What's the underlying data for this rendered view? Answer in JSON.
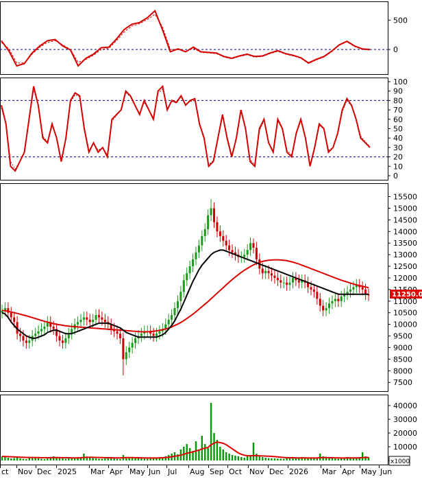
{
  "colors": {
    "primary_line": "#d40000",
    "signal_line": "#d40000",
    "ma_fast": "#000000",
    "ma_slow": "#dd0000",
    "up_candle": "#1a9a1a",
    "down_candle": "#cc0000",
    "volume": "#009900",
    "volume_ma": "#dd0000",
    "ref_line": "#00008b",
    "price_tag_bg": "#dd0000"
  },
  "current_price_label": "11250.00",
  "volume_unit_label": "x1000",
  "chart_data": [
    {
      "id": "macd",
      "type": "line",
      "yticks": [
        "500",
        "0"
      ],
      "ylim": [
        -350,
        750
      ],
      "reference_lines": [
        0
      ],
      "x": [
        0,
        4,
        8,
        12,
        16,
        20,
        24,
        28,
        32,
        36,
        40,
        44,
        48,
        52,
        56,
        60,
        64,
        68,
        72,
        76,
        80,
        84,
        88,
        92,
        96,
        100
      ],
      "series": [
        {
          "role": "macd",
          "values": [
            150,
            -30,
            -280,
            -240,
            -60,
            60,
            150,
            170,
            60,
            -10,
            -280,
            -150,
            -80,
            30,
            40,
            180,
            340,
            430,
            460,
            540,
            660,
            330,
            -40,
            10,
            -40,
            40
          ]
        },
        {
          "role": "signal",
          "values": [
            120,
            10,
            -230,
            -230,
            -80,
            40,
            120,
            150,
            80,
            0,
            -220,
            -170,
            -100,
            0,
            20,
            150,
            300,
            400,
            440,
            510,
            600,
            380,
            0,
            0,
            -30,
            20
          ]
        },
        {
          "role": "macd_cont",
          "values": [
            -40,
            -50,
            -60,
            -120,
            -150,
            -110,
            -80,
            -120,
            -110,
            -60,
            -20,
            -70,
            -100,
            -140,
            -230,
            -170,
            -120,
            -30,
            80,
            140,
            60,
            10,
            0
          ]
        }
      ]
    },
    {
      "id": "stochastic",
      "type": "line",
      "yticks": [
        "100",
        "90",
        "80",
        "70",
        "60",
        "50",
        "40",
        "30",
        "20",
        "10",
        "0"
      ],
      "ylim": [
        0,
        100
      ],
      "reference_lines": [
        80,
        20
      ],
      "series": [
        {
          "role": "k",
          "values": [
            75,
            55,
            10,
            5,
            15,
            25,
            60,
            95,
            75,
            40,
            35,
            55,
            40,
            15,
            40,
            80,
            88,
            85,
            50,
            25,
            35,
            25,
            30,
            20,
            60,
            65,
            70,
            90,
            85,
            75,
            65,
            80,
            70,
            60,
            90,
            95,
            70,
            80,
            78,
            85,
            75,
            80,
            82,
            55,
            40,
            10,
            15,
            40,
            65,
            40,
            20,
            40,
            70,
            50,
            15,
            10,
            50,
            60,
            35,
            25,
            60,
            50,
            25,
            20,
            45,
            60,
            40,
            10,
            30,
            55,
            50,
            25,
            30,
            45,
            70,
            82,
            75,
            60,
            40,
            35,
            30
          ]
        },
        {
          "role": "d",
          "values": [
            72,
            55,
            15,
            7,
            15,
            25,
            58,
            92,
            74,
            42,
            36,
            53,
            41,
            17,
            40,
            78,
            86,
            84,
            52,
            27,
            35,
            27,
            30,
            22,
            58,
            64,
            70,
            88,
            84,
            75,
            66,
            78,
            70,
            62,
            88,
            92,
            71,
            79,
            77,
            84,
            76,
            79,
            80,
            56,
            41,
            12,
            16,
            40,
            63,
            42,
            22,
            40,
            68,
            50,
            17,
            12,
            48,
            58,
            36,
            26,
            58,
            50,
            27,
            22,
            44,
            58,
            41,
            12,
            30,
            53,
            50,
            27,
            30,
            44,
            68,
            80,
            74,
            60,
            42,
            36,
            31
          ]
        }
      ]
    },
    {
      "id": "price",
      "type": "candlestick",
      "yticks": [
        "15500",
        "15000",
        "14500",
        "14000",
        "13500",
        "13000",
        "12500",
        "12000",
        "11500",
        "11000",
        "10500",
        "10000",
        "9500",
        "9000",
        "8500",
        "8000",
        "7500"
      ],
      "ylim": [
        7300,
        15900
      ],
      "x_labels": [
        "ct",
        "Nov",
        "Dec",
        "2025",
        "Mar",
        "Apr",
        "May",
        "Jun",
        "Jul",
        "Aug",
        "Sep",
        "Oct",
        "Nov",
        "Dec",
        "2026",
        "Mar",
        "Apr",
        "May",
        "Jun"
      ],
      "closes": [
        10600,
        10700,
        10500,
        10300,
        10100,
        9600,
        9500,
        9300,
        9200,
        9300,
        9500,
        9600,
        9700,
        9800,
        9900,
        10100,
        9900,
        9800,
        9500,
        9300,
        9200,
        9400,
        9600,
        9800,
        10000,
        10100,
        10200,
        10300,
        10200,
        10100,
        10200,
        10400,
        10300,
        10200,
        10100,
        10000,
        9800,
        9700,
        9600,
        9400,
        8500,
        8800,
        9000,
        9200,
        9400,
        9500,
        9600,
        9700,
        9700,
        9600,
        9500,
        9600,
        9700,
        9800,
        10000,
        10200,
        10400,
        10700,
        11000,
        11400,
        11900,
        12200,
        12500,
        12800,
        13100,
        13400,
        13800,
        14100,
        14700,
        15000,
        14400,
        14000,
        13800,
        13600,
        13400,
        13200,
        13100,
        13000,
        12900,
        12900,
        13000,
        13200,
        13500,
        13300,
        12800,
        12400,
        12200,
        12300,
        12200,
        12100,
        12000,
        11900,
        11800,
        11800,
        11700,
        11800,
        12000,
        11900,
        11800,
        11900,
        11800,
        11600,
        11500,
        11400,
        11100,
        10800,
        10600,
        10700,
        10900,
        11000,
        11100,
        11000,
        11200,
        11300,
        11400,
        11500,
        11600,
        11700,
        11600,
        11500,
        11300,
        11250
      ],
      "opens": [
        10500,
        10600,
        10700,
        10500,
        10300,
        10100,
        9600,
        9500,
        9300,
        9200,
        9300,
        9500,
        9600,
        9700,
        9800,
        9900,
        10100,
        9900,
        9800,
        9500,
        9300,
        9200,
        9400,
        9600,
        9800,
        10000,
        10100,
        10200,
        10300,
        10200,
        10100,
        10200,
        10400,
        10300,
        10200,
        10100,
        10000,
        9800,
        9700,
        9600,
        9400,
        8500,
        8800,
        9000,
        9200,
        9400,
        9500,
        9600,
        9700,
        9700,
        9600,
        9500,
        9600,
        9700,
        9800,
        10000,
        10200,
        10400,
        10700,
        11000,
        11400,
        11900,
        12200,
        12500,
        12800,
        13100,
        13400,
        13800,
        14100,
        14700,
        15000,
        14400,
        14000,
        13800,
        13600,
        13400,
        13200,
        13100,
        13000,
        12900,
        12900,
        13000,
        13200,
        13500,
        13300,
        12800,
        12400,
        12200,
        12300,
        12200,
        12100,
        12000,
        11900,
        11800,
        11800,
        11700,
        11800,
        12000,
        11900,
        11800,
        11900,
        11800,
        11600,
        11500,
        11400,
        11100,
        10800,
        10600,
        10700,
        10900,
        11000,
        11100,
        11000,
        11200,
        11300,
        11400,
        11500,
        11600,
        11700,
        11600,
        11500,
        11300
      ],
      "highs_extra": 250,
      "lows_extra": 250,
      "spikes": [
        {
          "index": 40,
          "low": 7800
        },
        {
          "index": 69,
          "high": 15400
        },
        {
          "index": 83,
          "high": 13700
        }
      ],
      "ma_fast": [
        10500,
        10450,
        10300,
        10100,
        9950,
        9800,
        9700,
        9600,
        9500,
        9450,
        9400,
        9400,
        9450,
        9500,
        9550,
        9650,
        9700,
        9750,
        9750,
        9700,
        9650,
        9600,
        9600,
        9600,
        9650,
        9700,
        9750,
        9800,
        9850,
        9900,
        9950,
        10000,
        10050,
        10050,
        10050,
        10050,
        10000,
        9950,
        9900,
        9850,
        9750,
        9650,
        9600,
        9550,
        9500,
        9450,
        9450,
        9450,
        9450,
        9450,
        9450,
        9450,
        9500,
        9550,
        9650,
        9800,
        9950,
        10150,
        10400,
        10650,
        10950,
        11250,
        11550,
        11850,
        12100,
        12350,
        12550,
        12700,
        12850,
        13000,
        13100,
        13150,
        13200,
        13200,
        13150,
        13100,
        13050,
        13000,
        12950,
        12900,
        12850,
        12800,
        12750,
        12700,
        12650,
        12600,
        12550,
        12500,
        12450,
        12400,
        12350,
        12300,
        12250,
        12200,
        12150,
        12100,
        12050,
        12000,
        11950,
        11900,
        11850,
        11800,
        11750,
        11700,
        11650,
        11600,
        11550,
        11500,
        11450,
        11400,
        11350,
        11300,
        11300,
        11300,
        11300,
        11300,
        11300,
        11300,
        11300,
        11300,
        11300,
        11300
      ],
      "ma_slow": [
        10600,
        10580,
        10560,
        10530,
        10500,
        10470,
        10440,
        10400,
        10370,
        10330,
        10290,
        10250,
        10210,
        10170,
        10130,
        10100,
        10060,
        10030,
        10000,
        9980,
        9960,
        9940,
        9920,
        9910,
        9900,
        9890,
        9880,
        9870,
        9860,
        9850,
        9840,
        9830,
        9820,
        9810,
        9800,
        9790,
        9780,
        9770,
        9760,
        9750,
        9740,
        9730,
        9720,
        9710,
        9700,
        9690,
        9680,
        9680,
        9680,
        9690,
        9700,
        9720,
        9740,
        9770,
        9800,
        9840,
        9890,
        9950,
        10010,
        10080,
        10160,
        10250,
        10340,
        10440,
        10540,
        10650,
        10760,
        10870,
        10980,
        11100,
        11220,
        11340,
        11460,
        11580,
        11700,
        11820,
        11930,
        12040,
        12140,
        12240,
        12330,
        12410,
        12490,
        12560,
        12620,
        12670,
        12710,
        12740,
        12760,
        12770,
        12780,
        12780,
        12770,
        12760,
        12740,
        12710,
        12680,
        12640,
        12600,
        12550,
        12500,
        12450,
        12400,
        12350,
        12300,
        12250,
        12200,
        12150,
        12100,
        12050,
        12000,
        11950,
        11900,
        11860,
        11820,
        11780,
        11740,
        11700,
        11670,
        11640,
        11610,
        11580
      ]
    },
    {
      "id": "volume",
      "type": "bar",
      "yticks": [
        "40000",
        "30000",
        "20000",
        "10000",
        "0"
      ],
      "ylim": [
        0,
        45000
      ],
      "values": [
        3000,
        2500,
        2000,
        1500,
        1800,
        2200,
        1500,
        1200,
        1000,
        1800,
        2500,
        2000,
        1500,
        1200,
        1000,
        1400,
        1600,
        3000,
        2500,
        2000,
        1500,
        1200,
        1800,
        1600,
        1400,
        2000,
        2500,
        5000,
        2800,
        2200,
        1800,
        1500,
        1300,
        1200,
        1400,
        1600,
        2000,
        1500,
        1200,
        1000,
        4000,
        2500,
        2000,
        1800,
        1600,
        1500,
        1400,
        1300,
        1200,
        1400,
        1600,
        1800,
        2000,
        2500,
        3000,
        4000,
        5000,
        6000,
        4500,
        8000,
        10000,
        12000,
        9000,
        7000,
        14000,
        8000,
        18000,
        12000,
        9000,
        42000,
        20000,
        15000,
        10000,
        8000,
        6000,
        5000,
        4000,
        3500,
        3000,
        2500,
        2000,
        3000,
        4000,
        13000,
        5000,
        3500,
        2500,
        2000,
        1800,
        1600,
        1500,
        1400,
        1300,
        1200,
        1500,
        2000,
        2500,
        1800,
        1500,
        2500,
        2000,
        1800,
        1500,
        1400,
        1600,
        5000,
        3000,
        2000,
        1800,
        1500,
        1400,
        1200,
        1500,
        2000,
        2500,
        2200,
        2000,
        1800,
        2500,
        6000,
        3000,
        2500
      ],
      "ma": [
        3000,
        2900,
        2800,
        2700,
        2600,
        2500,
        2400,
        2300,
        2200,
        2200,
        2200,
        2100,
        2100,
        2000,
        2000,
        2000,
        2000,
        2100,
        2100,
        2100,
        2000,
        2000,
        2000,
        1900,
        1900,
        1900,
        2000,
        2200,
        2300,
        2300,
        2300,
        2200,
        2200,
        2100,
        2000,
        2000,
        2000,
        1900,
        1900,
        1800,
        2000,
        2100,
        2100,
        2100,
        2000,
        2000,
        1900,
        1900,
        1800,
        1800,
        1800,
        1800,
        1900,
        2000,
        2200,
        2400,
        2700,
        3100,
        3400,
        3900,
        4500,
        5200,
        5800,
        6200,
        7000,
        7500,
        8400,
        9000,
        9500,
        11500,
        12500,
        13500,
        13000,
        12500,
        11500,
        10000,
        8500,
        7000,
        5500,
        4500,
        3800,
        3500,
        3300,
        3600,
        3500,
        3400,
        3300,
        3200,
        3100,
        3000,
        2800,
        2600,
        2400,
        2200,
        2000,
        2000,
        2000,
        1900,
        1900,
        1900,
        1900,
        1800,
        1800,
        1800,
        1800,
        2000,
        2100,
        2100,
        2000,
        2000,
        1900,
        1900,
        1800,
        1800,
        1900,
        1900,
        1900,
        1900,
        1900,
        2100,
        2200,
        2200
      ]
    }
  ]
}
